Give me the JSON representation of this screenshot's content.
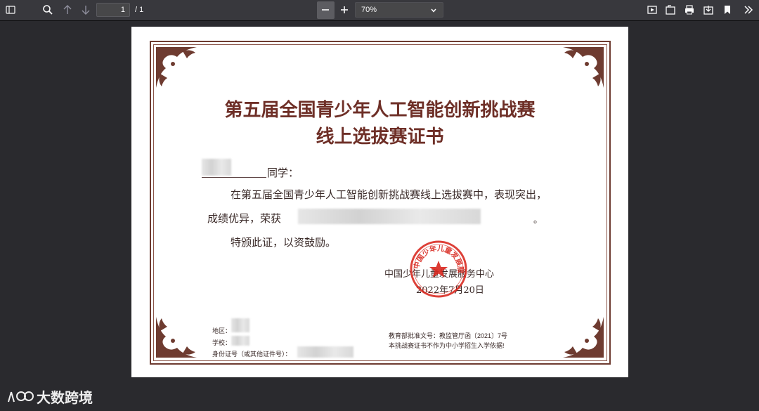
{
  "toolbar": {
    "page_number": "1",
    "page_total": "/ 1",
    "zoom_value": "70%",
    "icons": [
      "sidebar-toggle-icon",
      "search-icon",
      "previous-page-icon",
      "next-page-icon",
      "zoom-out-icon",
      "zoom-in-icon",
      "presentation-mode-icon",
      "open-file-icon",
      "print-icon",
      "download-icon",
      "bookmark-icon",
      "tools-icon"
    ]
  },
  "certificate": {
    "title_line1": "第五届全国青少年人工智能创新挑战赛",
    "title_line2": "线上选拔赛证书",
    "greeting": "同学：",
    "body_line1": "在第五届全国青少年人工智能创新挑战赛线上选拔赛中，表现突出，",
    "body_line2_prefix": "成绩优异，荣获",
    "body_line2_suffix": "。",
    "body_line3": "特颁此证，以资鼓励。",
    "issuer": "中国少年儿童发展服务中心",
    "date": "2022年7月20日",
    "seal_text": "中国少年儿童发展服务中心",
    "field_region": "地区：",
    "field_school": "学校：",
    "field_id": "身份证号（或其他证件号）：",
    "approval_no": "教育部批准文号：教监管厅函〔2021〕7号",
    "disclaimer": "本挑战赛证书不作为中小学招生入学依据!",
    "colors": {
      "title": "#6e2f27",
      "frame": "#6e3b30",
      "seal": "#d8261d"
    }
  },
  "watermark": {
    "text": "大数跨境"
  }
}
